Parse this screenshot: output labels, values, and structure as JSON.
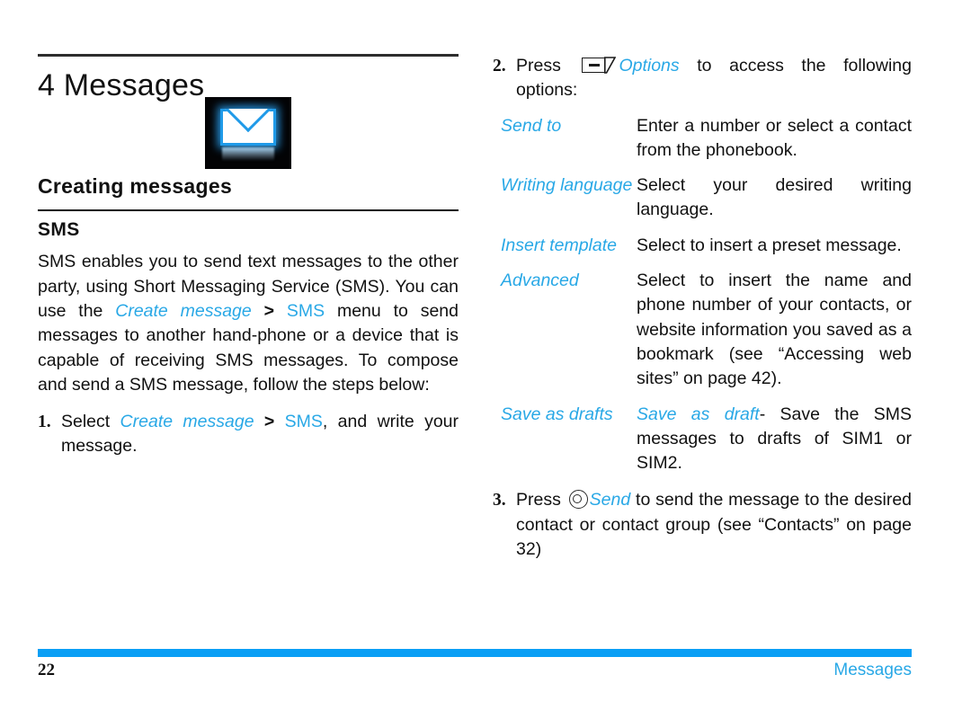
{
  "document": {
    "chapter_number_title": "4 Messages",
    "section_title": "Creating messages",
    "subsection_title": "SMS"
  },
  "icons": {
    "chapter_icon": "envelope-icon",
    "softkey_icon": "left-softkey-icon",
    "ok_icon": "ok-center-key-icon"
  },
  "colors": {
    "accent_blue": "#29a8e6",
    "footer_bar_blue": "#0a9ff5",
    "rule_dark": "#2e2e2e",
    "text": "#111111"
  },
  "left_column": {
    "intro_paragraph": {
      "part1": "SMS enables you to send text messages to the other party, using Short Messaging Service (SMS). You can use the ",
      "link1": "Create message",
      "sep1": ">",
      "link2": "SMS",
      "part2": " menu to send messages to another hand-phone or a device that is capable of receiving SMS messages. To compose and send a SMS message, follow the steps below:"
    },
    "step1": {
      "number": "1.",
      "part1": "Select ",
      "link1": "Create message",
      "sep1": ">",
      "link2": "SMS",
      "part2": ", and write your message."
    }
  },
  "right_column": {
    "step2": {
      "number": "2.",
      "part1": "Press ",
      "key_label": "Options",
      "part2": " to access the following options:"
    },
    "options": [
      {
        "term": "Send to",
        "description": "Enter a number or select a contact from the phonebook."
      },
      {
        "term": "Writing language",
        "description": "Select your desired writing language."
      },
      {
        "term": "Insert template",
        "description": "Select to insert a preset message."
      },
      {
        "term": "Advanced",
        "description": "Select to insert the name and phone number of your contacts, or website information you saved as a bookmark (see “Accessing web sites” on page 42)."
      }
    ],
    "save_as_drafts": {
      "term": "Save as drafts",
      "desc_link": "Save as draft",
      "desc_text": "- Save the SMS messages to drafts of SIM1 or SIM2."
    },
    "step3": {
      "number": "3.",
      "part1": "Press ",
      "key_label": "Send",
      "part2": " to send the message to the desired contact or contact group (see “Contacts” on page 32)"
    }
  },
  "footer": {
    "page_number": "22",
    "chapter_name": "Messages"
  }
}
